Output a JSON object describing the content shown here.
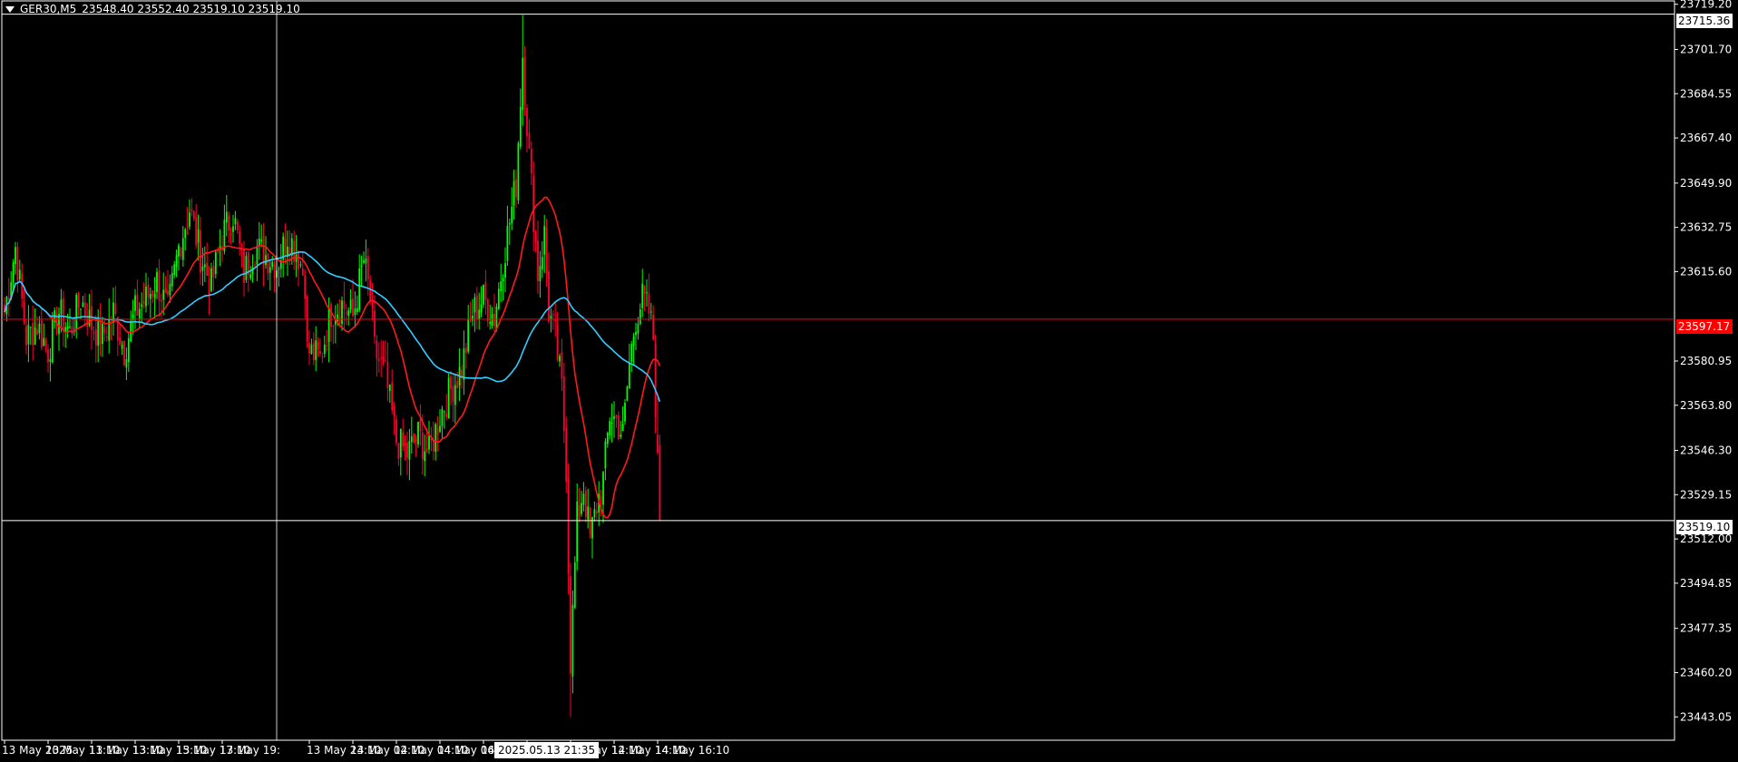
{
  "header": {
    "symbol": "GER30,M5",
    "ohlc": "23548.40 23552.40 23519.10 23519.10"
  },
  "colors": {
    "background": "#000000",
    "grid_frame": "#ffffff",
    "bull_candle": "#00ff00",
    "bear_candle": "#ff0033",
    "ma_fast": "#ff1a1a",
    "ma_slow": "#33ccff",
    "hline": "#ff0000"
  },
  "tags": {
    "top_price": "23715.36",
    "hline_price": "23597.17",
    "bid_price": "23519.10",
    "cursor_time": "2025.05.13 21:35"
  },
  "chart_data": {
    "type": "candlestick",
    "title": "GER30,M5",
    "ylim": [
      23434.0,
      23720.5
    ],
    "y_ticks": [
      "23719.20",
      "23701.70",
      "23684.55",
      "23667.40",
      "23649.90",
      "23632.75",
      "23615.60",
      "23597.17",
      "23580.95",
      "23563.80",
      "23546.30",
      "23529.15",
      "23512.00",
      "23494.85",
      "23477.35",
      "23460.20",
      "23443.05"
    ],
    "x_ticks": [
      "13 May 2025",
      "13 May 11:10",
      "13 May 13:10",
      "13 May 15:10",
      "13 May 17:10",
      "13 May 19:",
      "13 May 23:10",
      "14 May 02:10",
      "14 May 04:10",
      "14 May 06:10",
      "14 May 08:10",
      "14 May 10:10",
      "14 May 12:10",
      "14 May 14:10",
      "14 May 16:10"
    ],
    "x_tick_positions": [
      0,
      20,
      40,
      60,
      80,
      100,
      140,
      160,
      180,
      200,
      220,
      240,
      260,
      280,
      300
    ],
    "horizontal_lines": [
      {
        "value": 23597.17,
        "color": "#ff0000"
      },
      {
        "value": 23519.1,
        "color": "#ffffff"
      },
      {
        "value": 23715.36,
        "color": "#ffffff"
      }
    ],
    "cursor_bar_index": 125,
    "close_anchors": [
      [
        0,
        23600
      ],
      [
        5,
        23625
      ],
      [
        10,
        23590
      ],
      [
        15,
        23595
      ],
      [
        20,
        23585
      ],
      [
        25,
        23600
      ],
      [
        30,
        23592
      ],
      [
        35,
        23605
      ],
      [
        40,
        23595
      ],
      [
        45,
        23590
      ],
      [
        50,
        23600
      ],
      [
        55,
        23585
      ],
      [
        60,
        23600
      ],
      [
        65,
        23605
      ],
      [
        70,
        23612
      ],
      [
        75,
        23600
      ],
      [
        80,
        23625
      ],
      [
        85,
        23640
      ],
      [
        90,
        23622
      ],
      [
        95,
        23610
      ],
      [
        100,
        23630
      ],
      [
        105,
        23638
      ],
      [
        110,
        23615
      ],
      [
        115,
        23625
      ],
      [
        120,
        23622
      ],
      [
        125,
        23618
      ],
      [
        130,
        23630
      ],
      [
        135,
        23622
      ],
      [
        138,
        23612
      ],
      [
        139,
        23585
      ],
      [
        145,
        23582
      ],
      [
        150,
        23600
      ],
      [
        155,
        23603
      ],
      [
        160,
        23598
      ],
      [
        165,
        23620
      ],
      [
        168,
        23605
      ],
      [
        170,
        23585
      ],
      [
        175,
        23575
      ],
      [
        180,
        23550
      ],
      [
        185,
        23545
      ],
      [
        190,
        23552
      ],
      [
        195,
        23545
      ],
      [
        200,
        23560
      ],
      [
        205,
        23570
      ],
      [
        210,
        23578
      ],
      [
        215,
        23600
      ],
      [
        220,
        23605
      ],
      [
        225,
        23598
      ],
      [
        230,
        23625
      ],
      [
        235,
        23650
      ],
      [
        238,
        23700
      ],
      [
        241,
        23660
      ],
      [
        245,
        23615
      ],
      [
        248,
        23630
      ],
      [
        250,
        23600
      ],
      [
        253,
        23590
      ],
      [
        256,
        23570
      ],
      [
        258,
        23540
      ],
      [
        260,
        23465
      ],
      [
        263,
        23520
      ],
      [
        266,
        23532
      ],
      [
        269,
        23512
      ],
      [
        272,
        23525
      ],
      [
        275,
        23535
      ],
      [
        278,
        23560
      ],
      [
        281,
        23558
      ],
      [
        284,
        23552
      ],
      [
        287,
        23580
      ],
      [
        290,
        23598
      ],
      [
        293,
        23605
      ],
      [
        296,
        23600
      ],
      [
        298,
        23590
      ],
      [
        300,
        23540
      ],
      [
        301,
        23519.1
      ]
    ],
    "series": [
      {
        "name": "",
        "type": "ohlc",
        "values": "generated from close_anchors"
      },
      {
        "name": "",
        "type": "moving_average",
        "period": 20,
        "color": "#ff1a1a"
      },
      {
        "name": "",
        "type": "moving_average",
        "period": 60,
        "color": "#33ccff"
      }
    ]
  }
}
